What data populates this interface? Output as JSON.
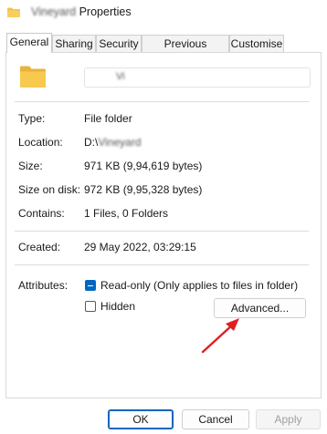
{
  "window": {
    "title_blurred": "Vineyard",
    "title": "Properties"
  },
  "tabs": [
    {
      "label": "General",
      "active": true
    },
    {
      "label": "Sharing",
      "active": false
    },
    {
      "label": "Security",
      "active": false
    },
    {
      "label": "Previous Versions",
      "active": false
    },
    {
      "label": "Customise",
      "active": false
    }
  ],
  "general": {
    "name_value": "Vi",
    "rows": {
      "type": {
        "label": "Type:",
        "value": "File folder"
      },
      "location": {
        "label": "Location:",
        "value_prefix": "D:\\",
        "value_blurred": "Vineyard"
      },
      "size": {
        "label": "Size:",
        "value": "971 KB (9,94,619 bytes)"
      },
      "size_on_disk": {
        "label": "Size on disk:",
        "value": "972 KB (9,95,328 bytes)"
      },
      "contains": {
        "label": "Contains:",
        "value": "1 Files, 0 Folders"
      },
      "created": {
        "label": "Created:",
        "value": "29 May 2022, 03:29:15"
      }
    },
    "attributes": {
      "label": "Attributes:",
      "readonly_label": "Read-only (Only applies to files in folder)",
      "readonly_state": "indeterminate",
      "hidden_label": "Hidden",
      "hidden_checked": false,
      "advanced_label": "Advanced..."
    }
  },
  "buttons": {
    "ok": "OK",
    "cancel": "Cancel",
    "apply": "Apply"
  },
  "colors": {
    "accent": "#0067c0",
    "arrow": "#e02020",
    "folder": "#f5c24a"
  }
}
